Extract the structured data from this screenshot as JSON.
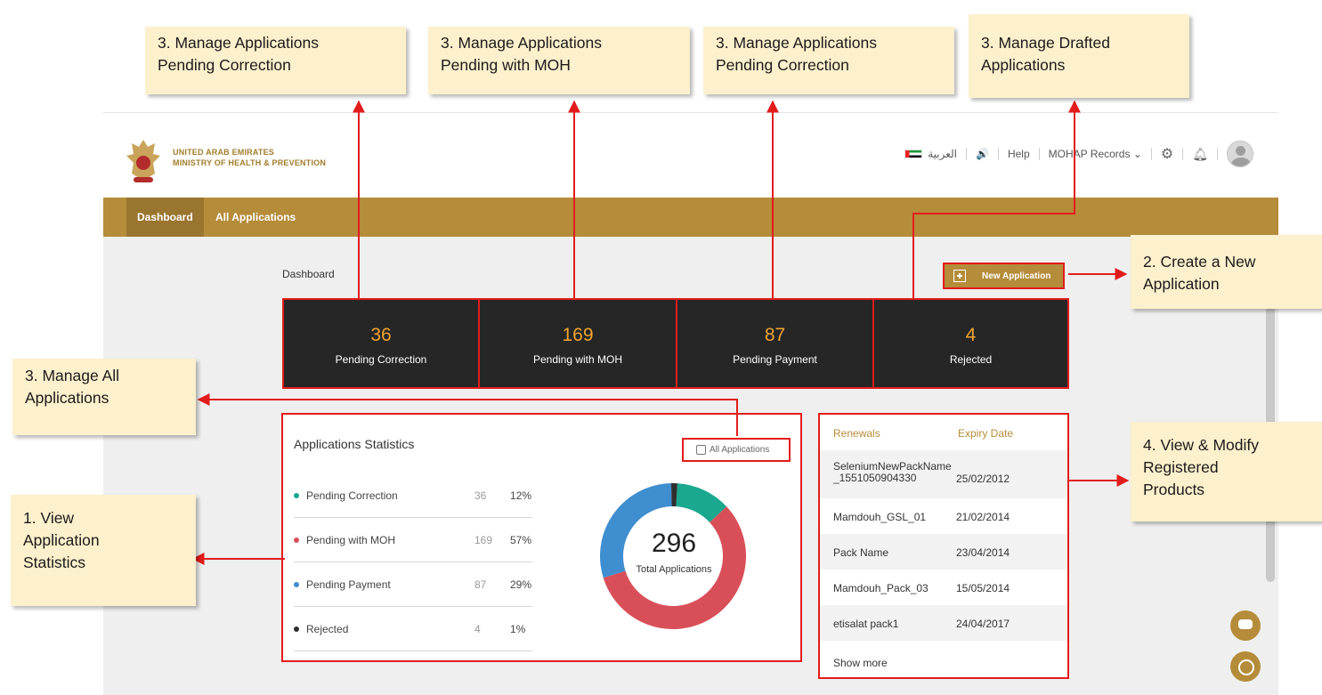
{
  "callouts": {
    "top1": [
      "3. Manage Applications",
      "Pending Correction"
    ],
    "top2": [
      "3. Manage Applications",
      "Pending with MOH"
    ],
    "top3": [
      "3. Manage Applications",
      "Pending Correction"
    ],
    "top4": [
      "3. Manage Drafted",
      "Applications"
    ],
    "create": [
      "2. Create a New",
      "Application"
    ],
    "all": [
      "3. Manage All",
      "Applications"
    ],
    "view_stats": [
      "1. View",
      "Application",
      "Statistics"
    ],
    "products": [
      "4. View & Modify",
      "Registered",
      "Products"
    ]
  },
  "header": {
    "org_line1": "UNITED ARAB EMIRATES",
    "org_line2": "MINISTRY OF HEALTH & PREVENTION",
    "language": "العربية",
    "help": "Help",
    "records_menu": "MOHAP Records"
  },
  "nav": {
    "tabs": [
      "Dashboard",
      "All Applications"
    ]
  },
  "breadcrumb": "Dashboard",
  "new_application_label": "New Application",
  "tiles": [
    {
      "count": "36",
      "label": "Pending Correction"
    },
    {
      "count": "169",
      "label": "Pending with MOH"
    },
    {
      "count": "87",
      "label": "Pending Payment"
    },
    {
      "count": "4",
      "label": "Rejected"
    }
  ],
  "statistics": {
    "title": "Applications Statistics",
    "all_applications_label": "All Applications",
    "rows": [
      {
        "name": "Pending Correction",
        "count": "36",
        "pct": "12%",
        "color": "#1aa88f"
      },
      {
        "name": "Pending with MOH",
        "count": "169",
        "pct": "57%",
        "color": "#d94f59"
      },
      {
        "name": "Pending Payment",
        "count": "87",
        "pct": "29%",
        "color": "#3e8ed0"
      },
      {
        "name": "Rejected",
        "count": "4",
        "pct": "1%",
        "color": "#2e2e2e"
      }
    ],
    "total": "296",
    "total_caption": "Total Applications"
  },
  "chart_data": {
    "type": "pie",
    "categories": [
      "Pending Correction",
      "Pending with MOH",
      "Pending Payment",
      "Rejected"
    ],
    "values": [
      36,
      169,
      87,
      4
    ],
    "colors": [
      "#1aa88f",
      "#d94f59",
      "#3e8ed0",
      "#2e2e2e"
    ]
  },
  "renewals": {
    "col_name": "Renewals",
    "col_date": "Expiry Date",
    "rows": [
      {
        "name1": "SeleniumNewPackName",
        "name2": "_1551050904330",
        "date": "25/02/2012"
      },
      {
        "name": "Mamdouh_GSL_01",
        "date": "21/02/2014"
      },
      {
        "name": "Pack Name",
        "date": "23/04/2014"
      },
      {
        "name": "Mamdouh_Pack_03",
        "date": "15/05/2014"
      },
      {
        "name": "etisalat pack1",
        "date": "24/04/2017"
      }
    ],
    "show_more": "Show more"
  },
  "colors": {
    "brand": "#b58c3a",
    "accent_number": "#f0a431",
    "annotation": "#e21c1c",
    "callout_bg": "#fdf0cc"
  }
}
